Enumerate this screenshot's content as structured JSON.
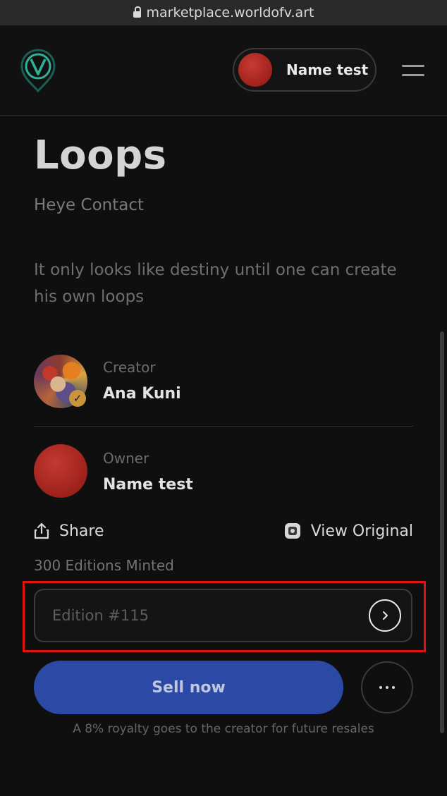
{
  "browser": {
    "url": "marketplace.worldofv.art"
  },
  "header": {
    "profile_name": "Name test"
  },
  "artwork": {
    "title": "Loops",
    "collection": "Heye Contact",
    "description": "It only looks like destiny until one can create his own loops"
  },
  "creator": {
    "label": "Creator",
    "name": "Ana Kuni"
  },
  "owner": {
    "label": "Owner",
    "name": "Name test"
  },
  "actions": {
    "share_label": "Share",
    "view_original_label": "View Original"
  },
  "editions": {
    "minted_text": "300 Editions Minted",
    "edition_placeholder": "Edition #115"
  },
  "sell": {
    "button_label": "Sell now",
    "royalty_note": "A 8% royalty goes to the creator for future resales"
  },
  "colors": {
    "accent": "#2c4aa5",
    "highlight": "#e01212",
    "owner_avatar": "#c33a31"
  }
}
